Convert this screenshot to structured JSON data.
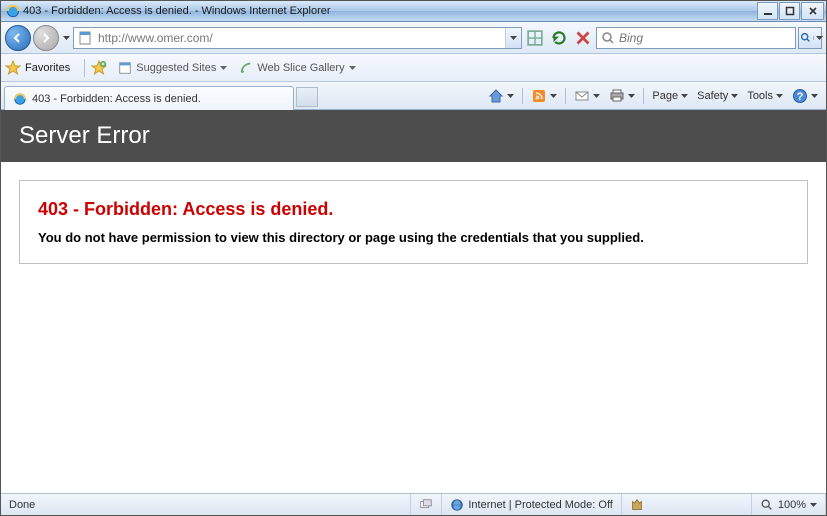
{
  "window": {
    "title": "403 - Forbidden: Access is denied. - Windows Internet Explorer"
  },
  "address": {
    "url": "http://www.omer.com/"
  },
  "search": {
    "placeholder": "Bing"
  },
  "favorites": {
    "label": "Favorites",
    "suggested": "Suggested Sites",
    "webslice": "Web Slice Gallery"
  },
  "tab": {
    "title": "403 - Forbidden: Access is denied."
  },
  "commands": {
    "page": "Page",
    "safety": "Safety",
    "tools": "Tools"
  },
  "page": {
    "header": "Server Error",
    "title": "403 - Forbidden: Access is denied.",
    "body": "You do not have permission to view this directory or page using the credentials that you supplied."
  },
  "status": {
    "left": "Done",
    "zone": "Internet | Protected Mode: Off",
    "zoom": "100%"
  }
}
